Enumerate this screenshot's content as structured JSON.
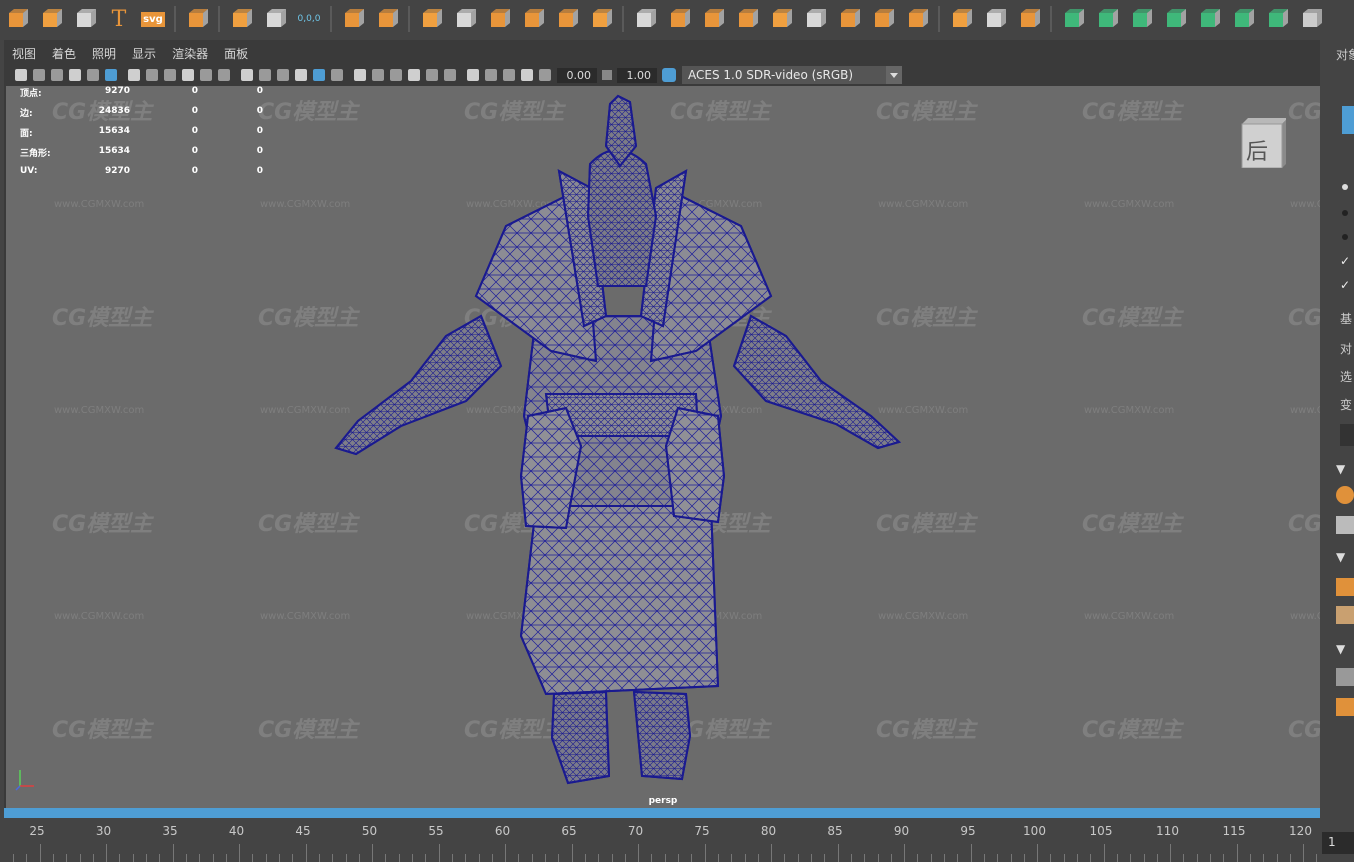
{
  "shelf": {
    "icons": [
      "diamond-tool-icon",
      "sparkle-icon",
      "spring-icon",
      "text-t-icon",
      "svg-icon",
      "separator",
      "grid-icon",
      "separator",
      "look-through-icon",
      "snap-icon",
      "coord-readout-icon",
      "separator",
      "select-lasso-icon",
      "plane-icon",
      "separator",
      "cube-group-icon",
      "box-icon",
      "cube-grid-icon",
      "cube-stack-icon",
      "cube-arrow-icon",
      "cube-circle-icon",
      "separator",
      "cube-cut-icon",
      "extrude-icon",
      "box-3d-icon",
      "cube-bevel-icon",
      "sphere-icon",
      "bridge-icon",
      "plane-stack-icon",
      "frame-icon",
      "sphere-cube-icon",
      "separator",
      "pen-icon",
      "bounding-box-icon",
      "pen-curve-icon",
      "separator",
      "green-cube-icon",
      "green-cylinder-icon",
      "green-cone-icon",
      "green-box-icon",
      "green-snake-icon",
      "green-checker-icon",
      "green-pipe-icon",
      "close-x-icon"
    ],
    "coord_text": "0,0,0",
    "svg_text": "svg"
  },
  "panel_menu": [
    "视图",
    "着色",
    "照明",
    "显示",
    "渲染器",
    "面板"
  ],
  "panel_toolbar": {
    "field1": "0.00",
    "field2": "1.00",
    "colorspace": "ACES 1.0 SDR-video (sRGB)"
  },
  "hud": {
    "rows": [
      {
        "label": "顶点:",
        "v1": "9270",
        "v2": "0",
        "v3": "0"
      },
      {
        "label": "边:",
        "v1": "24836",
        "v2": "0",
        "v3": "0"
      },
      {
        "label": "面:",
        "v1": "15634",
        "v2": "0",
        "v3": "0"
      },
      {
        "label": "三角形:",
        "v1": "15634",
        "v2": "0",
        "v3": "0"
      },
      {
        "label": "UV:",
        "v1": "9270",
        "v2": "0",
        "v3": "0"
      }
    ]
  },
  "viewcube_label": "后",
  "camera_label": "persp",
  "watermark": {
    "logo": "CG模型主",
    "url": "www.CGMXW.com"
  },
  "timeline": {
    "ticks": [
      "25",
      "30",
      "35",
      "40",
      "45",
      "50",
      "55",
      "60",
      "65",
      "70",
      "75",
      "80",
      "85",
      "90",
      "95",
      "100",
      "105",
      "110",
      "115",
      "120"
    ]
  },
  "right_panel": {
    "tab": "对象",
    "labels": [
      "基",
      "对",
      "选",
      "变"
    ]
  },
  "frame_field": "1"
}
